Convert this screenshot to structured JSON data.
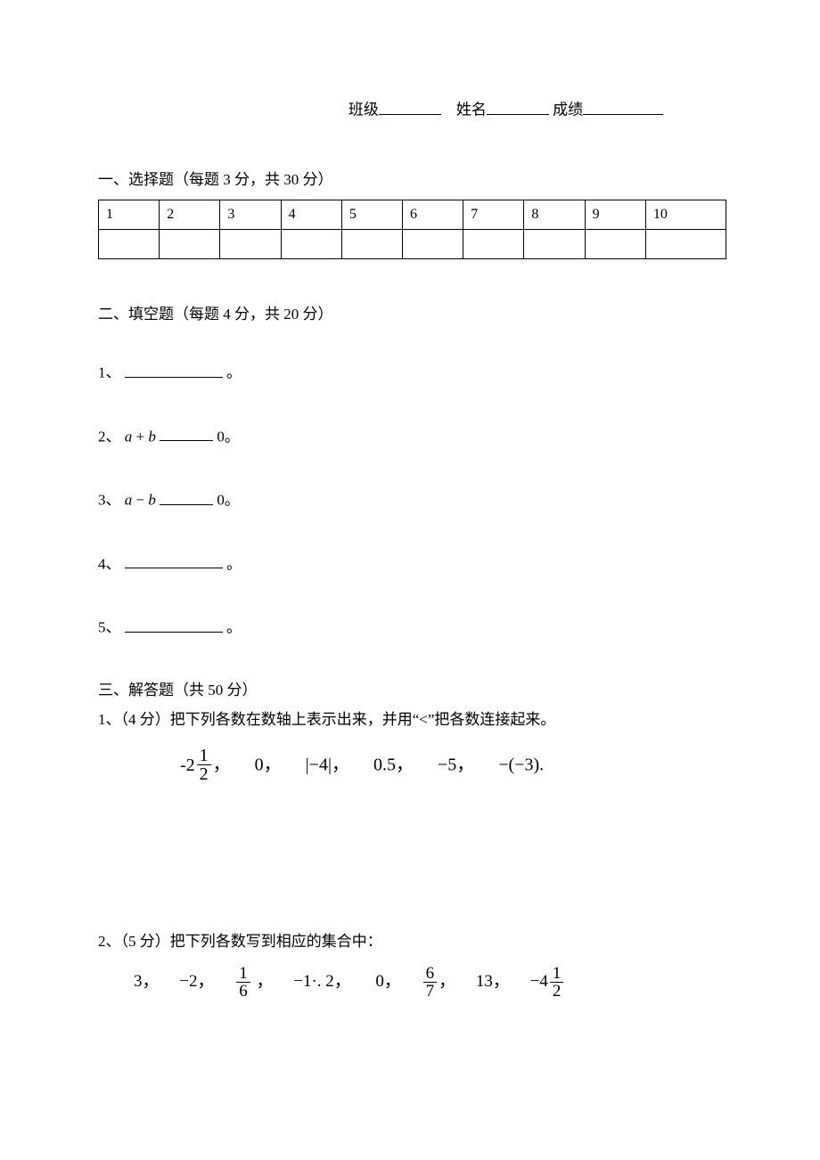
{
  "header": {
    "class_label": "班级",
    "name_label": "姓名",
    "score_label": "成绩"
  },
  "section1": {
    "heading": "一、选择题（每题 3 分，共 30 分）",
    "cols": [
      "1",
      "2",
      "3",
      "4",
      "5",
      "6",
      "7",
      "8",
      "9",
      "10"
    ]
  },
  "section2": {
    "heading": "二、填空题（每题 4 分，共 20 分）",
    "q1_pre": "1、",
    "q1_suffix": "。",
    "q2_pre": "2、 ",
    "q2_expr_a": "a",
    "q2_expr_op": " + ",
    "q2_expr_b": "b",
    "q2_tail": "0。",
    "q3_pre": "3、 ",
    "q3_expr_a": "a",
    "q3_expr_op": " − ",
    "q3_expr_b": "b",
    "q3_tail": "0。",
    "q4_pre": "4、",
    "q4_suffix": "。",
    "q5_pre": "5、",
    "q5_suffix": "。"
  },
  "section3": {
    "heading": "三、解答题（共 50 分）",
    "q1_text": "1、（4 分）把下列各数在数轴上表示出来，并用“<”把各数连接起来。",
    "q1_nums": {
      "n1_neg": "-",
      "n1_int": "2",
      "n1_num": "1",
      "n1_den": "2",
      "sep": "，",
      "n2": "0",
      "n3": "|−4|",
      "n4": "0.5",
      "n5": "−5",
      "n6": "−(−3)",
      "end": "."
    },
    "q2_text": "2、（5 分）把下列各数写到相应的集合中：",
    "q2_nums": {
      "a1": "3",
      "a2": "−2",
      "a3_num": "1",
      "a3_den": "6",
      "a4": "−1·. 2",
      "a5": "0",
      "a6_num": "6",
      "a6_den": "7",
      "a7": "13",
      "a8_neg": "−",
      "a8_int": "4",
      "a8_num": "1",
      "a8_den": "2",
      "sep": "，"
    }
  }
}
